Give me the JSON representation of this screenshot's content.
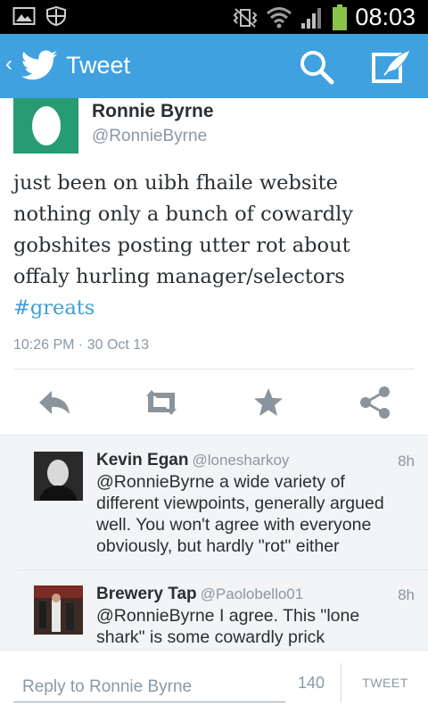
{
  "status_bar": {
    "time": "08:03",
    "icons": [
      "gallery-icon",
      "shield-icon",
      "no-vibrate-icon",
      "wifi-icon",
      "signal-icon",
      "battery-icon"
    ]
  },
  "action_bar": {
    "title": "Tweet",
    "icons": [
      "back-icon",
      "twitter-logo",
      "search-icon",
      "compose-icon"
    ],
    "color": "#3fa1e0"
  },
  "tweet": {
    "author_name": "Ronnie Byrne",
    "author_handle": "@RonnieByrne",
    "text_lines": [
      "just been on uibh fhaile website",
      "nothing only a bunch of cowardly",
      "gobshites posting utter rot about",
      "offaly hurling manager/selectors"
    ],
    "hashtag": "#greats",
    "timestamp": "10:26 PM · 30 Oct 13",
    "actions": [
      "reply-icon",
      "retweet-icon",
      "favorite-icon",
      "share-icon"
    ]
  },
  "replies": [
    {
      "name": "Kevin Egan",
      "handle": "@lonesharkoy",
      "age": "8h",
      "text_lines": [
        "@RonnieByrne a wide variety of",
        "different viewpoints, generally argued",
        "well. You won't agree with everyone",
        "obviously, but hardly \"rot\" either"
      ]
    },
    {
      "name": "Brewery Tap",
      "handle": "@Paolobello01",
      "age": "8h",
      "text_lines": [
        "@RonnieByrne I agree. This \"lone",
        "shark\" is some cowardly prick"
      ]
    }
  ],
  "composer": {
    "placeholder": "Reply to Ronnie Byrne",
    "char_count": "140",
    "button_label": "TWEET"
  }
}
